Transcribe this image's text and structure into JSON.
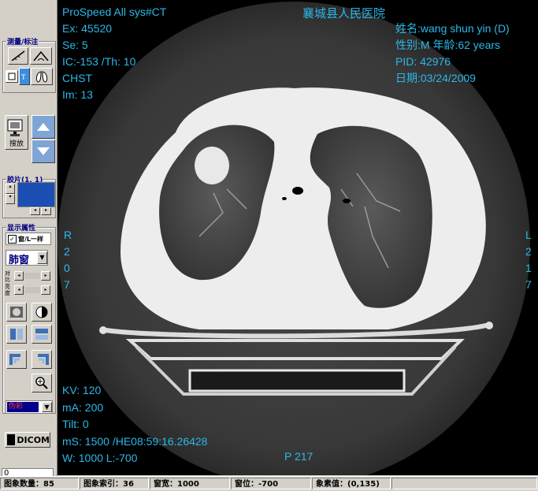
{
  "sidebar": {
    "measure_group_title": "测量/标注",
    "scroll_label": "搜放",
    "film_group_title": "胶片(1, 1)",
    "display_group_title": "显示属性",
    "same_checkbox_label": "窗/L一样",
    "window_preset": "肺窗",
    "contrast_label_1": "对比",
    "contrast_label_2": "亮度",
    "color_select": "伪彩",
    "dicom_button": "DICOM",
    "frame_input_value": "0"
  },
  "overlay": {
    "top_left": [
      "ProSpeed All  sys#CT",
      "Ex: 45520",
      "Se: 5",
      "IC:-153 /Th: 10",
      "CHST",
      "Im: 13"
    ],
    "hospital": "襄城县人民医院",
    "top_right": [
      "姓名:wang shun yin (D)",
      "性别:M  年龄:62 years",
      "PID: 42976",
      "日期:03/24/2009"
    ],
    "left_side": [
      "R",
      "2",
      "0",
      "7"
    ],
    "right_side": [
      "L",
      "2",
      "1",
      "7"
    ],
    "bottom_left": [
      "KV: 120",
      "mA: 200",
      "Tilt: 0",
      "mS: 1500  /HE08:59:16.26428",
      "W: 1000 L:-700"
    ],
    "bottom_center": "P 217"
  },
  "status": {
    "count": "图象数量：85",
    "index": "图象索引：36",
    "width": "窗宽：1000",
    "level": "窗位：-700",
    "pixel": "象素值：(0,135)"
  },
  "colors": {
    "overlay_text": "#2bb8e8",
    "arrow_button": "#7fa5d6",
    "film_preview": "#1c4fb4"
  }
}
